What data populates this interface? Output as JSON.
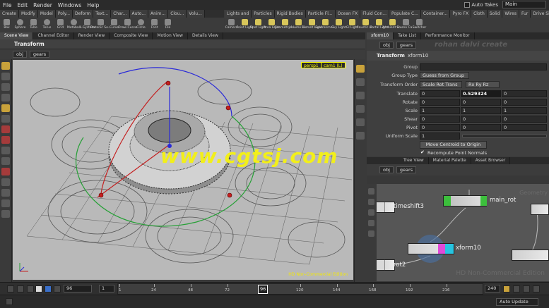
{
  "menu": [
    "File",
    "Edit",
    "Render",
    "Windows",
    "Help"
  ],
  "menu_right": {
    "auto_takes": "Auto Takes",
    "desktop": "Main"
  },
  "shelf_tabs_left": [
    "Create",
    "Modify",
    "Model",
    "Poly...",
    "Deform",
    "Text...",
    "Char...",
    "Auto...",
    "Anim...",
    "Clou...",
    "Volu..."
  ],
  "shelf_tabs_right": [
    "Lights and",
    "Particles",
    "Rigid Bodies",
    "Particle Fl...",
    "Ocean FX",
    "Fluid Con...",
    "Populate C...",
    "Container...",
    "Pyro FX",
    "Cloth",
    "Solid",
    "Wires",
    "Fur",
    "Drive Sim..."
  ],
  "tools_left": [
    "Box",
    "Sphere",
    "Tube",
    "Torus",
    "Grid",
    "Metaball",
    "L-System",
    "Platonic So...",
    "Curve",
    "Draw Curve",
    "Circle",
    "Font",
    "File"
  ],
  "tools_right": [
    "Camera",
    "Point Light",
    "Spot Light",
    "Area Light",
    "Geometry L...",
    "Volume Li...",
    "Distant Light",
    "Environme...",
    "Sky Light",
    "GI Light",
    "Caustic Li...",
    "Portal Light",
    "Ambient Li...",
    "Stereo Ca...",
    "Switcher"
  ],
  "left_pane_tabs": [
    "Scene View",
    "Channel Editor",
    "Render View",
    "Composite View",
    "Motion View",
    "Details View"
  ],
  "viewer": {
    "title": "Transform",
    "path_obj": "obj",
    "path_node": "gears",
    "persp": "persp1",
    "cam": "cam1 (L)",
    "watermark": "www.cgtsj.com",
    "edition": "HD Non-Commercial Edition"
  },
  "right_pane_tabs": [
    "xform10",
    "Take List",
    "Performance Monitor"
  ],
  "params": {
    "path_obj": "obj",
    "path_node": "gears",
    "watermark": "rohan dalvi create",
    "title_type": "Transform",
    "title_node": "xform10",
    "group_label": "Group",
    "group_value": "",
    "group_type_label": "Group Type",
    "group_type_value": "Guess from Group",
    "transform_order_label": "Transform Order",
    "transform_order_value": "Scale Rot Trans",
    "rot_order_value": "Rx Ry Rz",
    "translate_label": "Translate",
    "translate": [
      "0",
      "0.529324",
      "0"
    ],
    "rotate_label": "Rotate",
    "rotate": [
      "0",
      "0",
      "0"
    ],
    "scale_label": "Scale",
    "scale": [
      "1",
      "1",
      "1"
    ],
    "shear_label": "Shear",
    "shear": [
      "0",
      "0",
      "0"
    ],
    "pivot_label": "Pivot",
    "pivot": [
      "0",
      "0",
      "0"
    ],
    "uniform_scale_label": "Uniform Scale",
    "uniform_scale": "1",
    "move_centroid": "Move Centroid to Origin",
    "recompute_normals": "Recompute Point Normals"
  },
  "network_tabs": [
    "Tree View",
    "Material Palette",
    "Asset Browser"
  ],
  "network": {
    "path_obj": "obj",
    "path_node": "gears",
    "nodes": [
      "timeshift3",
      "main_rot",
      "xform10",
      "rot2"
    ],
    "watermark": "HD Non-Commercial Edition",
    "watermark_top": "Geometry"
  },
  "timeline": {
    "current_frame": "96",
    "start_frame": "1",
    "end_frame": "240",
    "ticks": [
      "1",
      "24",
      "48",
      "72",
      "96",
      "120",
      "144",
      "168",
      "192",
      "216"
    ],
    "auto_update": "Auto Update"
  },
  "colors": {
    "viewport_bg": "#b9b9b9",
    "watermark": "#f2ef1a",
    "network_bg": "#565656",
    "play_button": "#3a6fc9"
  }
}
